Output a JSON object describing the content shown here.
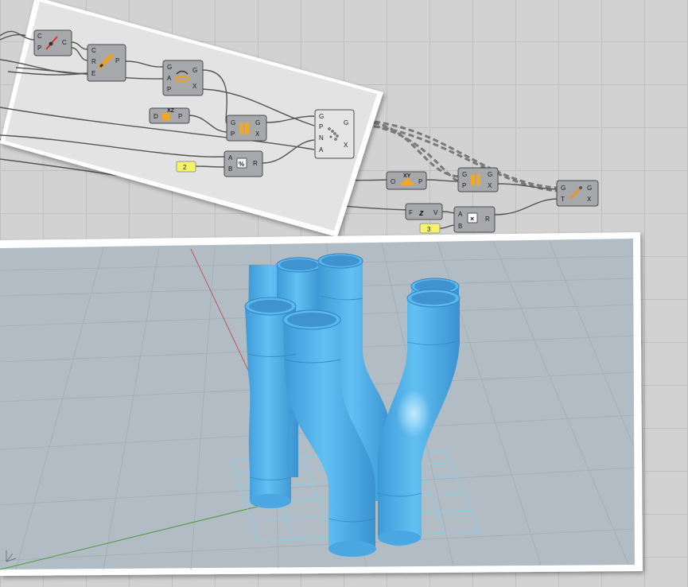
{
  "app": {
    "name": "Grasshopper / Rhino definition"
  },
  "colors": {
    "canvas": "#d2d2d2",
    "canvas_grid": "#c0c0c0",
    "component_fill": "#a6a8ab",
    "component_stroke": "#4a4a4a",
    "wire": "#555555",
    "panel_yellow": "#f4f36a",
    "pipe_blue": "#5bb8ef",
    "viewport_bg": "#b2bcc5",
    "axis_red": "#b85a55",
    "axis_green": "#4c9a3a",
    "grid_cyan": "#7fd2f0"
  },
  "components": {
    "c1": {
      "inputs": [
        "C",
        "P"
      ],
      "outputs": [
        "C"
      ],
      "icon": "evaluate-curve-icon"
    },
    "c2": {
      "inputs": [
        "C",
        "R",
        "E"
      ],
      "outputs": [
        "P"
      ],
      "icon": "divide-curve-pencil-icon"
    },
    "c3": {
      "inputs": [
        "G",
        "A",
        "P"
      ],
      "outputs": [
        "G",
        "X"
      ],
      "icon": "rotate-icon"
    },
    "c4": {
      "inputs": [
        "D"
      ],
      "outputs": [
        "P"
      ],
      "icon": "xz-plane-icon",
      "icon_text": "XZ"
    },
    "c5": {
      "inputs": [
        "G",
        "P"
      ],
      "outputs": [
        "G",
        "X"
      ],
      "icon": "orient-pipes-icon"
    },
    "c6": {
      "inputs": [
        "A",
        "B"
      ],
      "outputs": [
        "R"
      ],
      "icon": "division-icon"
    },
    "c7": {
      "inputs": [
        "G",
        "P",
        "N",
        "A"
      ],
      "outputs": [
        "G",
        "X"
      ],
      "icon": "point-deform-icon"
    },
    "c8": {
      "inputs": [
        "O"
      ],
      "outputs": [
        "P"
      ],
      "icon": "xy-plane-icon",
      "icon_text": "XY"
    },
    "c9": {
      "inputs": [
        "G",
        "P"
      ],
      "outputs": [
        "G",
        "X"
      ],
      "icon": "orient-pipes-icon"
    },
    "c10": {
      "inputs": [
        "G",
        "T"
      ],
      "outputs": [
        "G",
        "X"
      ],
      "icon": "move-icon"
    },
    "c11": {
      "inputs": [
        "F"
      ],
      "outputs": [
        "V"
      ],
      "icon": "unit-z-icon"
    },
    "c12": {
      "inputs": [
        "A",
        "B"
      ],
      "outputs": [
        "R"
      ],
      "icon": "multiplication-icon"
    }
  },
  "panels": {
    "p1": {
      "value": "2"
    },
    "p2": {
      "value": "3"
    }
  },
  "viewport": {
    "corner_axes_icon": "world-axes-icon"
  }
}
